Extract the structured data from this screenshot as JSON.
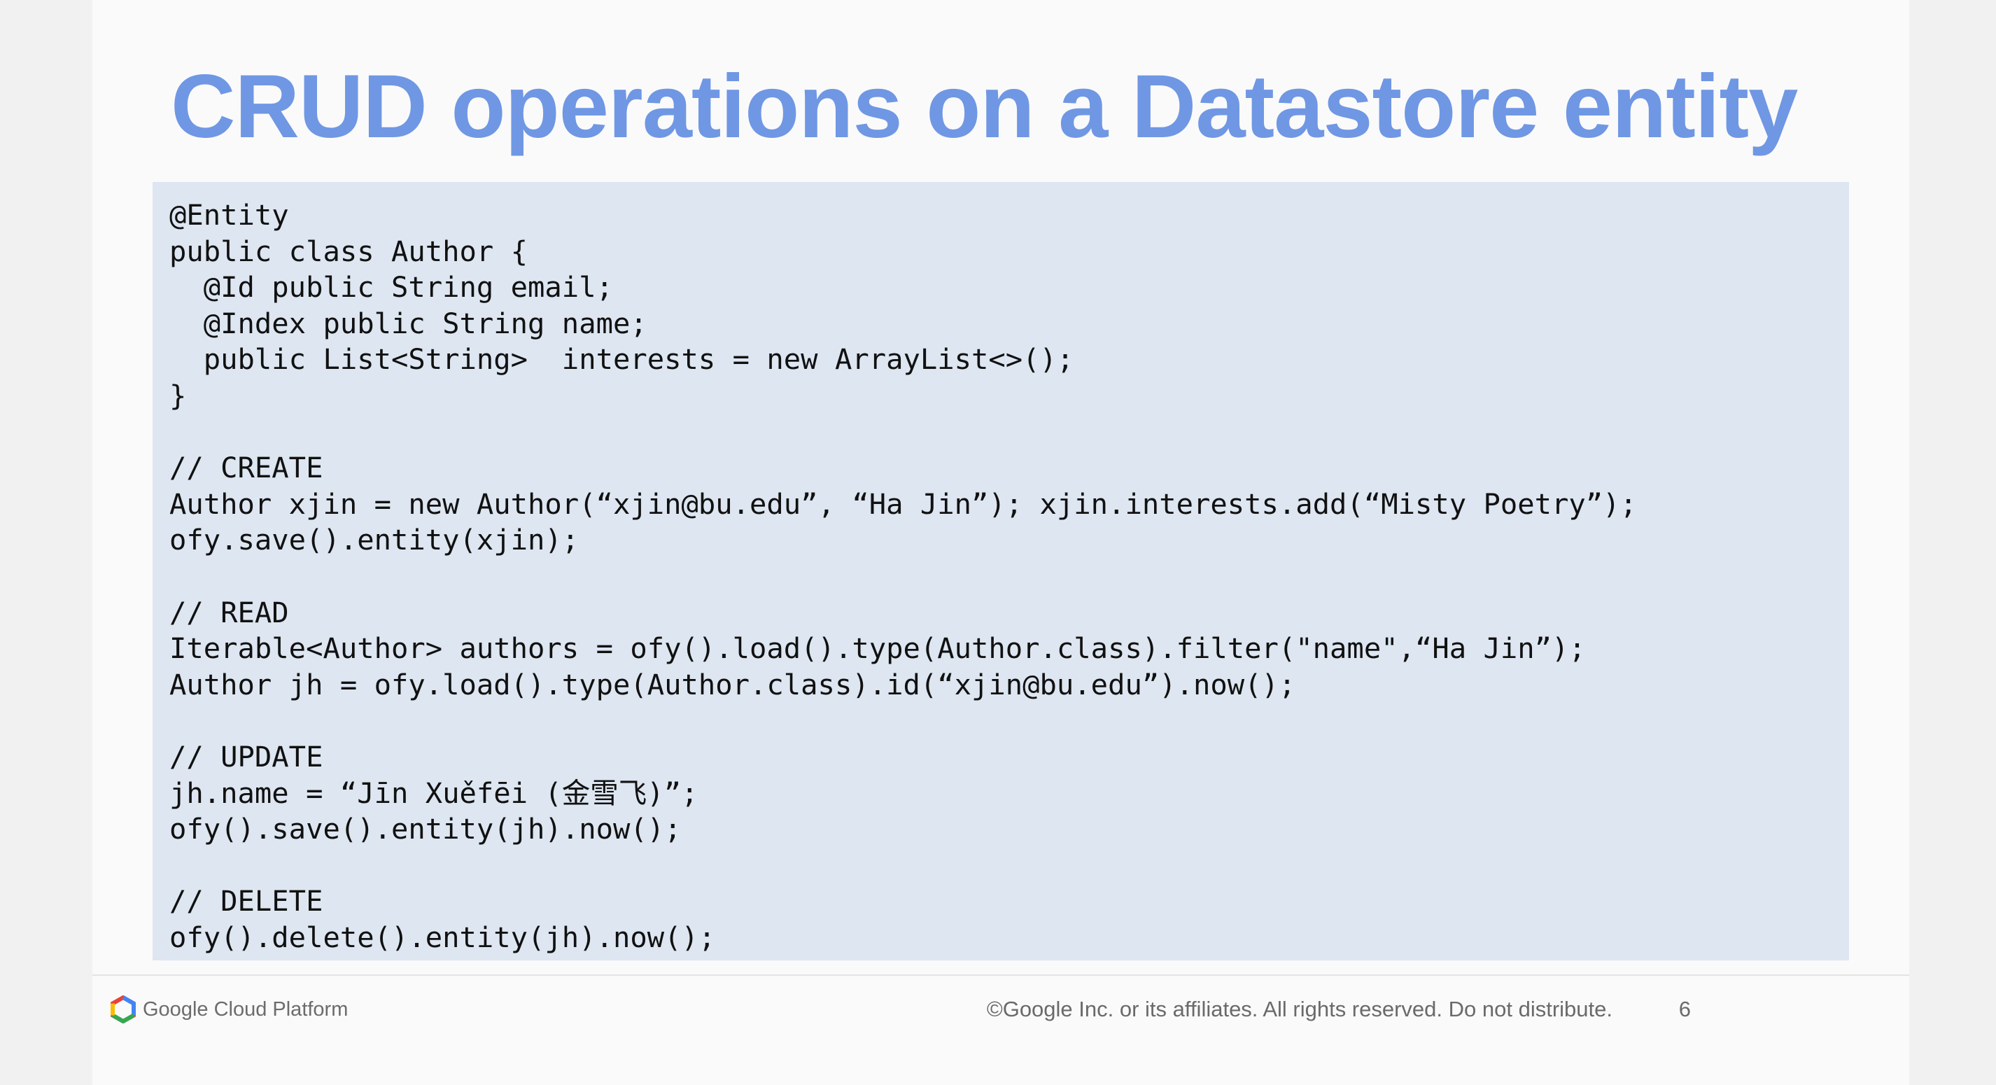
{
  "slide": {
    "title": "CRUD operations on a Datastore entity",
    "page_number": "6"
  },
  "code": {
    "lines": [
      "@Entity",
      "public class Author {",
      "  @Id public String email;",
      "  @Index public String name;",
      "  public List<String>  interests = new ArrayList<>();",
      "}",
      "",
      "// CREATE",
      "Author xjin = new Author(“xjin@bu.edu”, “Ha Jin”); xjin.interests.add(“Misty Poetry”);",
      "ofy.save().entity(xjin);",
      "",
      "// READ",
      "Iterable<Author> authors = ofy().load().type(Author.class).filter(\"name\",“Ha Jin”);",
      "Author jh = ofy.load().type(Author.class).id(“xjin@bu.edu”).now();",
      "",
      "// UPDATE",
      "jh.name = “Jīn Xuěfēi (金雪飞)”;",
      "ofy().save().entity(jh).now();",
      "",
      "// DELETE",
      "ofy().delete().entity(jh).now();"
    ]
  },
  "footer": {
    "brand": "Google Cloud Platform",
    "brand_icon": "google-cloud-hexagon-icon",
    "copyright": "©Google Inc. or its affiliates. All rights reserved. Do not distribute."
  },
  "colors": {
    "title": "#6f97e4",
    "code_background": "#dde6f1",
    "footer_text": "#6a6a6a"
  }
}
